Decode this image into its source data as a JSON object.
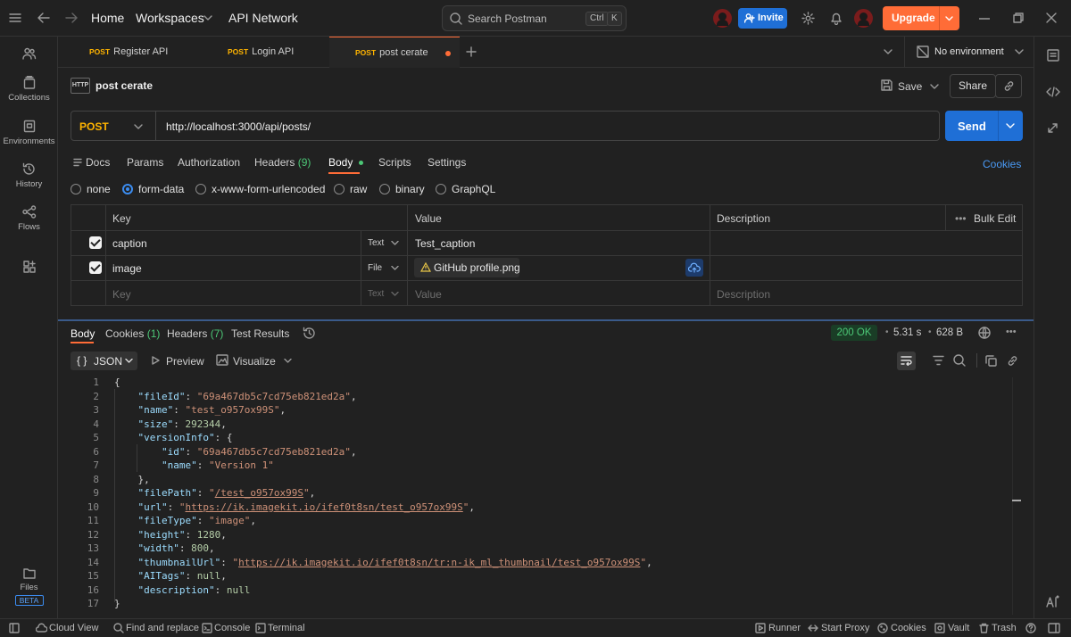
{
  "topbar": {
    "home": "Home",
    "workspaces": "Workspaces",
    "workspace_name": "API Network",
    "search_placeholder": "Search Postman",
    "kbd_ctrl": "Ctrl",
    "kbd_k": "K",
    "invite": "Invite",
    "upgrade": "Upgrade"
  },
  "sidebar": {
    "items": [
      {
        "label": "",
        "icon": "team-icon"
      },
      {
        "label": "Collections",
        "icon": "collections-icon"
      },
      {
        "label": "Environments",
        "icon": "environments-icon"
      },
      {
        "label": "History",
        "icon": "history-icon"
      },
      {
        "label": "Flows",
        "icon": "flows-icon"
      },
      {
        "label": "",
        "icon": "apps-icon"
      }
    ],
    "files_label": "Files",
    "beta_label": "BETA"
  },
  "tabs": [
    {
      "method": "POST",
      "name": "Register API"
    },
    {
      "method": "POST",
      "name": "Login API"
    },
    {
      "method": "POST",
      "name": "post cerate"
    }
  ],
  "environment": "No environment",
  "request": {
    "name": "post cerate",
    "save": "Save",
    "share": "Share",
    "method": "POST",
    "url": "http://localhost:3000/api/posts/",
    "send": "Send",
    "tabs": {
      "docs": "Docs",
      "params": "Params",
      "authorization": "Authorization",
      "headers": "Headers",
      "headers_count": "(9)",
      "body": "Body",
      "scripts": "Scripts",
      "settings": "Settings"
    },
    "cookies": "Cookies",
    "body_types": [
      "none",
      "form-data",
      "x-www-form-urlencoded",
      "raw",
      "binary",
      "GraphQL"
    ],
    "selected_body_type": "form-data"
  },
  "params_table": {
    "headers": {
      "key": "Key",
      "value": "Value",
      "description": "Description",
      "bulk_edit": "Bulk Edit"
    },
    "rows": [
      {
        "key": "caption",
        "type": "Text",
        "value": "Test_caption",
        "checked": true
      },
      {
        "key": "image",
        "type": "File",
        "value": "GitHub profile.png",
        "checked": true
      }
    ],
    "placeholder": {
      "key": "Key",
      "type": "Text",
      "value": "Value",
      "description": "Description"
    }
  },
  "response": {
    "tabs": {
      "body": "Body",
      "cookies": "Cookies",
      "cookies_count": "(1)",
      "headers": "Headers",
      "headers_count": "(7)",
      "test_results": "Test Results"
    },
    "status": "200 OK",
    "time": "5.31 s",
    "size": "628 B",
    "format": "JSON",
    "preview": "Preview",
    "visualize": "Visualize",
    "json": {
      "fileId": "69a467db5c7cd75eb821ed2a",
      "name": "test_o957ox99S",
      "size": "292344",
      "versionInfo_id": "69a467db5c7cd75eb821ed2a",
      "versionInfo_name": "Version 1",
      "filePath": "/test_o957ox99S",
      "url": "https://ik.imagekit.io/ifef0t8sn/test_o957ox99S",
      "fileType": "image",
      "height": "1280",
      "width": "800",
      "thumbnailUrl": "https://ik.imagekit.io/ifef0t8sn/tr:n-ik_ml_thumbnail/test_o957ox99S",
      "AITags": "null",
      "description": "null"
    },
    "line_numbers": [
      "1",
      "2",
      "3",
      "4",
      "5",
      "6",
      "7",
      "8",
      "9",
      "10",
      "11",
      "12",
      "13",
      "14",
      "15",
      "16",
      "17"
    ]
  },
  "footer": {
    "cloud_view": "Cloud View",
    "find_replace": "Find and replace",
    "console": "Console",
    "terminal": "Terminal",
    "runner": "Runner",
    "start_proxy": "Start Proxy",
    "cookies": "Cookies",
    "vault": "Vault",
    "trash": "Trash"
  }
}
